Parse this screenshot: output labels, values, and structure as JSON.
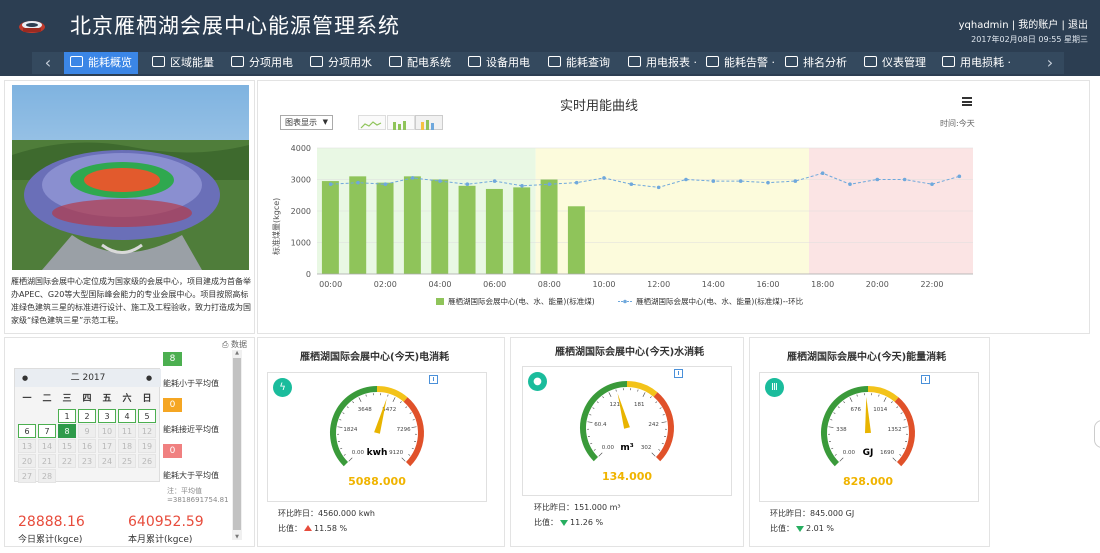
{
  "header": {
    "title": "北京雁栖湖会展中心能源管理系统",
    "user": "yqhadmin",
    "account_link": "我的账户",
    "logout_link": "退出",
    "datetime": "2017年02月08日 09:55 星期三"
  },
  "nav": {
    "items": [
      {
        "label": "能耗概览",
        "icon": "book-icon",
        "active": true
      },
      {
        "label": "区域能量",
        "icon": "network-icon"
      },
      {
        "label": "分项用电",
        "icon": "plug-icon"
      },
      {
        "label": "分项用水",
        "icon": "drop-icon"
      },
      {
        "label": "配电系统",
        "icon": "monitor-icon"
      },
      {
        "label": "设备用电",
        "icon": "power-icon"
      },
      {
        "label": "能耗查询",
        "icon": "document-icon"
      },
      {
        "label": "用电报表 ·",
        "icon": "report-icon"
      },
      {
        "label": "能耗告警 ·",
        "icon": "warning-icon"
      },
      {
        "label": "排名分析",
        "icon": "list-icon"
      },
      {
        "label": "仪表管理",
        "icon": "meter-icon"
      },
      {
        "label": "用电损耗 ·",
        "icon": "loss-icon"
      }
    ]
  },
  "intro": {
    "text": "雁栖湖国际会展中心定位成为国家级的会展中心，项目建成为首备举办APEC、G20等大型国际峰会能力的专业会展中心。项目按照高标准绿色建筑三星的标准进行设计、施工及工程验收，致力打造成为国家级“绿色建筑三星”示范工程。"
  },
  "chart": {
    "title": "实时用能曲线",
    "select_label": "图表显示",
    "time_label": "时间:今天",
    "ylabel": "标准煤量(kgce)",
    "legend_bar": "雁栖湖国际会展中心(电、水、能量)(标准煤)",
    "legend_line": "雁栖湖国际会展中心(电、水、能量)(标准煤)--环比"
  },
  "chart_data": {
    "type": "bar",
    "categories": [
      "00:00",
      "01:00",
      "02:00",
      "03:00",
      "04:00",
      "05:00",
      "06:00",
      "07:00",
      "08:00",
      "09:00",
      "10:00",
      "11:00",
      "12:00",
      "13:00",
      "14:00",
      "15:00",
      "16:00",
      "17:00",
      "18:00",
      "19:00",
      "20:00",
      "21:00",
      "22:00",
      "23:00"
    ],
    "x_tick_labels": [
      "00:00",
      "02:00",
      "04:00",
      "06:00",
      "08:00",
      "10:00",
      "12:00",
      "14:00",
      "16:00",
      "18:00",
      "20:00",
      "22:00"
    ],
    "ylim": [
      0,
      4000
    ],
    "yticks": [
      0,
      1000,
      2000,
      3000,
      4000
    ],
    "series": [
      {
        "name": "雁栖湖国际会展中心(电、水、能量)(标准煤)",
        "type": "bar",
        "color": "#8fc45a",
        "values": [
          2950,
          3100,
          2900,
          3100,
          3000,
          2800,
          2700,
          2750,
          3000,
          2150,
          null,
          null,
          null,
          null,
          null,
          null,
          null,
          null,
          null,
          null,
          null,
          null,
          null,
          null
        ]
      },
      {
        "name": "雁栖湖国际会展中心(电、水、能量)(标准煤)--环比",
        "type": "line",
        "color": "#6fa8dc",
        "values": [
          2850,
          2900,
          2850,
          3050,
          2950,
          2850,
          2950,
          2800,
          2850,
          2900,
          3050,
          2850,
          2750,
          3000,
          2950,
          2950,
          2900,
          2950,
          3200,
          2850,
          3000,
          3000,
          2850,
          3100
        ]
      }
    ],
    "bands": [
      {
        "from": 0,
        "to": 8,
        "color": "#e9f8e4"
      },
      {
        "from": 8,
        "to": 18,
        "color": "#fcfbdc"
      },
      {
        "from": 18,
        "to": 24,
        "color": "#fbe4e4"
      }
    ],
    "grid": true
  },
  "calendar": {
    "data_link": "数据",
    "year_label": "二 2017",
    "weekdays": [
      "一",
      "二",
      "三",
      "四",
      "五",
      "六",
      "日"
    ],
    "rows": [
      [
        "",
        "",
        "1",
        "2",
        "3",
        "4",
        "5"
      ],
      [
        "6",
        "7",
        "8",
        "9",
        "10",
        "11",
        "12"
      ],
      [
        "13",
        "14",
        "15",
        "16",
        "17",
        "18",
        "19"
      ],
      [
        "20",
        "21",
        "22",
        "23",
        "24",
        "25",
        "26"
      ],
      [
        "27",
        "28",
        "",
        "",
        "",
        "",
        ""
      ]
    ],
    "today": "8",
    "current_through": 7
  },
  "legend": {
    "low_count": "8",
    "low_label": "能耗小于平均值",
    "mid_count": "0",
    "mid_label": "能耗接近平均值",
    "high_count": "0",
    "high_label": "能耗大于平均值",
    "note": "注：平均值\n=3818691754.81",
    "colors": {
      "low": "#4caf50",
      "mid": "#f5a623",
      "high": "#f08080"
    }
  },
  "totals": {
    "today_value": "28888.16",
    "today_label": "今日累计(kgce)",
    "month_value": "640952.59",
    "month_label": "本月累计(kgce)"
  },
  "gauges": [
    {
      "title": "雁栖湖国际会展中心(今天)电消耗",
      "icon": "lightning-icon",
      "unit": "kwh",
      "value": "5088.000",
      "ticks": [
        "0.00",
        "1824",
        "3648",
        "5472",
        "7296",
        "9120"
      ],
      "max": 9120,
      "current": 5088,
      "footer_line1": "环比昨日：4560.000 kwh",
      "ratio_label": "比值：",
      "ratio_value": "11.58 %",
      "trend": "up"
    },
    {
      "title": "雁栖湖国际会展中心(今天)水消耗",
      "icon": "drop-icon",
      "unit": "m³",
      "value": "134.000",
      "ticks": [
        "0.00",
        "60.4",
        "121",
        "181",
        "242",
        "302"
      ],
      "max": 302,
      "current": 134,
      "footer_line1": "环比昨日：151.000 m³",
      "ratio_label": "比值：",
      "ratio_value": "11.26 %",
      "trend": "down"
    },
    {
      "title": "雁栖湖国际会展中心(今天)能量消耗",
      "icon": "radiator-icon",
      "unit": "GJ",
      "value": "828.000",
      "ticks": [
        "0.00",
        "338",
        "676",
        "1014",
        "1352",
        "1690"
      ],
      "max": 1690,
      "current": 828,
      "footer_line1": "环比昨日：845.000 GJ",
      "ratio_label": "比值：",
      "ratio_value": "2.01 %",
      "trend": "down"
    }
  ]
}
